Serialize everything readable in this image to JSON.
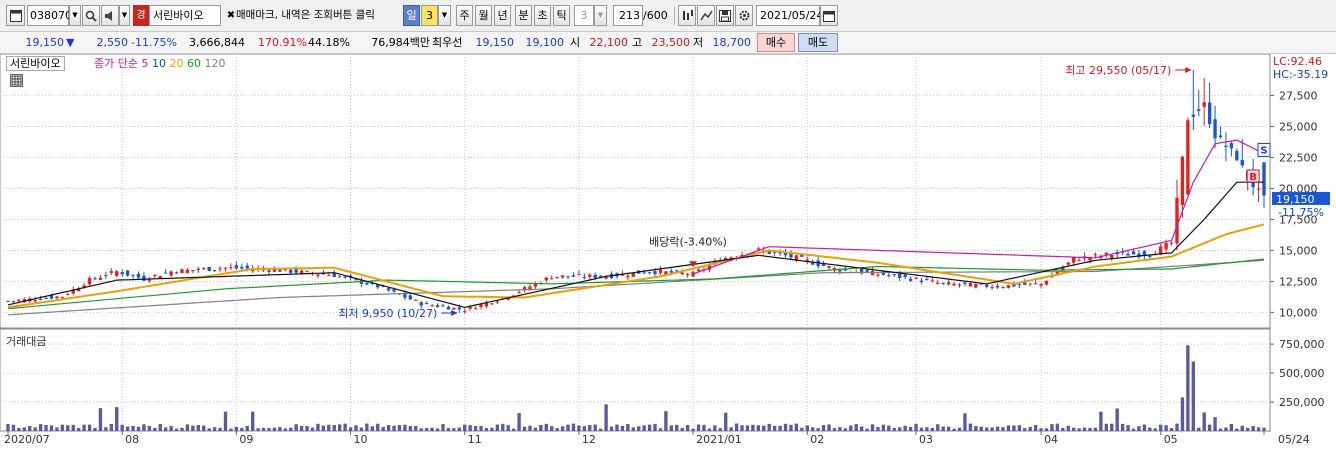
{
  "toolbar": {
    "stock_code": "038070",
    "market_badge": "경",
    "stock_name": "서린바이오",
    "trade_mark_label": "매매마크, 내역은 조회버튼 클릭",
    "period_day": "일",
    "period_value": "3",
    "period_week": "주",
    "period_month": "월",
    "period_year": "년",
    "period_minute": "분",
    "period_second": "초",
    "period_tick": "틱",
    "tick_value": "3",
    "count_value": "213",
    "count_max": "/600",
    "date_value": "2021/05/24"
  },
  "info": {
    "price": "19,150",
    "change": "2,550",
    "change_pct": "-11.75%",
    "volume": "3,666,844",
    "vol_ratio": "170.91%",
    "turnover": "44.18%",
    "amount": "76,984백만",
    "best_bid_label": "최우선",
    "best_ask": "19,150",
    "best_bid": "19,100",
    "open_label": "시",
    "open": "22,100",
    "high_label": "고",
    "high": "23,500",
    "low_label": "저",
    "low": "18,700",
    "buy_label": "매수",
    "sell_label": "매도"
  },
  "legend": {
    "name": "서린바이오",
    "series_prefix": "종가 단순",
    "ma5": "5",
    "ma10": "10",
    "ma20": "20",
    "ma60": "60",
    "ma120": "120",
    "volume_label": "거래대금"
  },
  "annotations": {
    "high_label": "최고 29,550 (05/17)",
    "low_label": "최저 9,950 (10/27)",
    "dividend_label": "배당락(-3.40%)",
    "lc": "LC:92.46",
    "hc": "HC:-35.19",
    "current_price": "19,150",
    "current_pct": "-11.75%",
    "marker_s": "S",
    "marker_b": "B"
  },
  "colors": {
    "up": "#e0211e",
    "down": "#1a55d6",
    "ma5": "#c81aa0",
    "ma10": "#101010",
    "ma20": "#e8a00c",
    "ma60": "#1c9a2c",
    "ma120": "#808080",
    "volume": "#5a5aa0"
  },
  "chart_data": {
    "type": "candlestick",
    "price_axis": [
      "27,500",
      "25,000",
      "22,500",
      "20,000",
      "17,500",
      "15,000",
      "12,500",
      "10,000"
    ],
    "price_axis_values": [
      27500,
      25000,
      22500,
      20000,
      17500,
      15000,
      12500,
      10000
    ],
    "volume_axis": [
      "750,000",
      "500,000",
      "250,000"
    ],
    "volume_axis_values": [
      750000,
      500000,
      250000
    ],
    "x_labels": [
      "2020/07",
      "08",
      "09",
      "10",
      "11",
      "12",
      "2021/01",
      "02",
      "03",
      "04",
      "05",
      "05/24"
    ],
    "x_label_index": [
      0,
      21,
      42,
      63,
      84,
      105,
      126,
      147,
      167,
      190,
      212,
      231
    ],
    "n_days": 232,
    "close_points": [
      [
        0,
        10900
      ],
      [
        10,
        11300
      ],
      [
        15,
        12600
      ],
      [
        20,
        13300
      ],
      [
        25,
        12700
      ],
      [
        30,
        13300
      ],
      [
        40,
        13600
      ],
      [
        50,
        13400
      ],
      [
        60,
        13000
      ],
      [
        68,
        12100
      ],
      [
        76,
        10700
      ],
      [
        84,
        10200
      ],
      [
        92,
        11300
      ],
      [
        100,
        12900
      ],
      [
        110,
        12900
      ],
      [
        118,
        13300
      ],
      [
        126,
        13100
      ],
      [
        132,
        14400
      ],
      [
        138,
        15000
      ],
      [
        145,
        14400
      ],
      [
        152,
        13500
      ],
      [
        162,
        13000
      ],
      [
        172,
        12300
      ],
      [
        182,
        12100
      ],
      [
        190,
        12300
      ],
      [
        196,
        14300
      ],
      [
        203,
        14700
      ],
      [
        210,
        14700
      ],
      [
        214,
        15600
      ],
      [
        217,
        25700
      ],
      [
        220,
        26700
      ],
      [
        222,
        24300
      ],
      [
        226,
        22500
      ],
      [
        228,
        20800
      ],
      [
        231,
        19150
      ]
    ],
    "ma": {
      "ma5": [
        [
          126,
          13100
        ],
        [
          140,
          15300
        ],
        [
          200,
          14400
        ],
        [
          214,
          15800
        ],
        [
          218,
          20500
        ],
        [
          222,
          23600
        ],
        [
          226,
          23900
        ],
        [
          231,
          22800
        ]
      ],
      "ma10": [
        [
          0,
          10600
        ],
        [
          20,
          12600
        ],
        [
          60,
          13200
        ],
        [
          84,
          10400
        ],
        [
          110,
          12900
        ],
        [
          138,
          14600
        ],
        [
          180,
          12300
        ],
        [
          200,
          14200
        ],
        [
          214,
          14800
        ],
        [
          220,
          17500
        ],
        [
          226,
          20500
        ],
        [
          231,
          20500
        ]
      ],
      "ma20": [
        [
          0,
          10400
        ],
        [
          20,
          11700
        ],
        [
          45,
          13500
        ],
        [
          60,
          13600
        ],
        [
          80,
          11300
        ],
        [
          95,
          11200
        ],
        [
          120,
          12900
        ],
        [
          140,
          15000
        ],
        [
          160,
          14000
        ],
        [
          185,
          12300
        ],
        [
          200,
          13700
        ],
        [
          214,
          14500
        ],
        [
          224,
          16300
        ],
        [
          231,
          17100
        ]
      ],
      "ma60": [
        [
          0,
          10300
        ],
        [
          40,
          11900
        ],
        [
          70,
          12600
        ],
        [
          100,
          12300
        ],
        [
          130,
          12700
        ],
        [
          160,
          13700
        ],
        [
          190,
          13400
        ],
        [
          214,
          13500
        ],
        [
          231,
          14300
        ]
      ],
      "ma120": [
        [
          0,
          9800
        ],
        [
          50,
          11200
        ],
        [
          100,
          11900
        ],
        [
          150,
          13200
        ],
        [
          200,
          13300
        ],
        [
          231,
          14200
        ]
      ]
    },
    "high": {
      "value": 29550,
      "date": "05/17"
    },
    "low": {
      "value": 9950,
      "date": "10/27"
    },
    "last_close": 19150,
    "last_change_pct": -11.75
  }
}
